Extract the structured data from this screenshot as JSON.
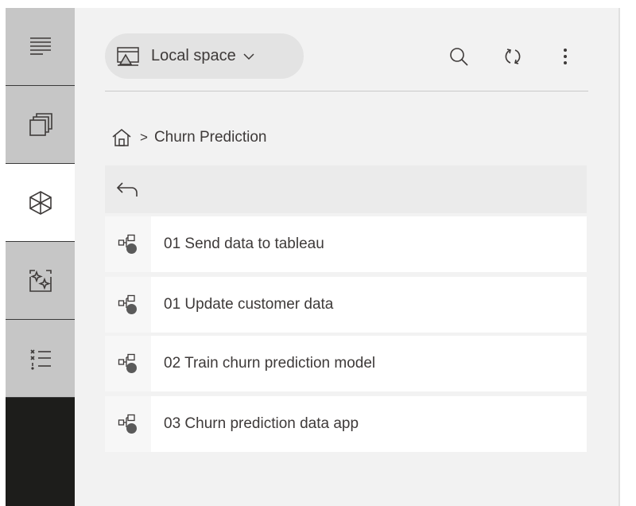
{
  "header": {
    "space_selector": {
      "label": "Local space",
      "icon": "local-space-icon",
      "chevron": "chevron-down-icon"
    },
    "tools": [
      "search-icon",
      "refresh-icon",
      "more-vertical-icon"
    ]
  },
  "sidebar_rail": {
    "items": [
      {
        "name": "description",
        "icon": "document-lines-icon",
        "active": false
      },
      {
        "name": "space-explorer",
        "icon": "stacked-windows-icon",
        "active": false
      },
      {
        "name": "node-repository",
        "icon": "cube-icon",
        "active": true
      },
      {
        "name": "ai-assistant",
        "icon": "sparkle-frame-icon",
        "active": false
      },
      {
        "name": "monitor",
        "icon": "checklist-icon",
        "active": false
      }
    ]
  },
  "breadcrumb": {
    "home_icon": "home-icon",
    "separator": ">",
    "current": "Churn Prediction"
  },
  "back": {
    "icon": "back-arrow-icon"
  },
  "workflows": [
    {
      "label": "01 Send data to tableau",
      "icon": "workflow-icon"
    },
    {
      "label": "01 Update customer data",
      "icon": "workflow-icon"
    },
    {
      "label": "02 Train churn prediction model",
      "icon": "workflow-icon"
    },
    {
      "label": "03 Churn prediction data app",
      "icon": "workflow-icon"
    }
  ]
}
